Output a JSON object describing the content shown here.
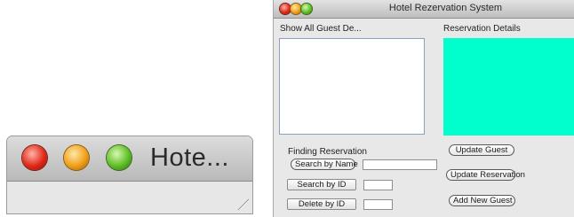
{
  "mini_window": {
    "title": "Hote...",
    "controls": [
      "close",
      "minimize",
      "zoom"
    ]
  },
  "window": {
    "title": "Hotel Rezervation System"
  },
  "left_panel": {
    "header": "Show All Guest De...",
    "finding_title": "Finding Reservation",
    "search_name_button": "Search by Name",
    "search_name_value": "",
    "search_id_button": "Search by ID",
    "search_id_value": "",
    "delete_id_button": "Delete by ID",
    "delete_id_value": ""
  },
  "right_panel": {
    "header": "Reservation Details",
    "panel_color": "#00ffcc",
    "update_guest_button": "Update Guest",
    "update_reservation_button": "Update Reservation",
    "add_guest_button": "Add New Guest"
  }
}
